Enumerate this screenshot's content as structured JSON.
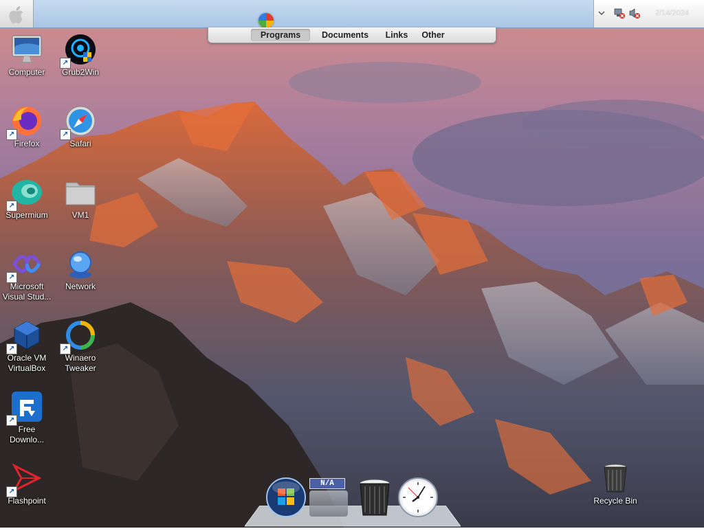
{
  "topbar": {
    "tray": {
      "clock": "2/14/2024"
    }
  },
  "tabs": [
    {
      "label": "Programs",
      "active": true
    },
    {
      "label": "Documents",
      "active": false
    },
    {
      "label": "Links",
      "active": false
    },
    {
      "label": "Other",
      "active": false
    }
  ],
  "desktop": {
    "icons": [
      {
        "label": "Computer",
        "icon": "monitor-icon"
      },
      {
        "label": "Grub2Win",
        "icon": "grub2win-icon"
      },
      {
        "label": "Firefox",
        "icon": "firefox-icon"
      },
      {
        "label": "Safari",
        "icon": "safari-icon"
      },
      {
        "label": "Supermium",
        "icon": "supermium-icon"
      },
      {
        "label": "VM1",
        "icon": "folder-icon"
      },
      {
        "label": "Microsoft Visual Stud...",
        "icon": "visual-studio-icon"
      },
      {
        "label": "Network",
        "icon": "network-icon"
      },
      {
        "label": "Oracle VM VirtualBox",
        "icon": "virtualbox-icon"
      },
      {
        "label": "Winaero Tweaker",
        "icon": "winaero-icon"
      },
      {
        "label": "Free Downlo...",
        "icon": "free-download-manager-icon"
      },
      {
        "label": "Flashpoint",
        "icon": "flashpoint-icon"
      },
      {
        "label": "Recycle Bin",
        "icon": "recycle-bin-icon"
      }
    ]
  },
  "dock": {
    "badge": "N/A",
    "items": [
      "start-orb-icon",
      "stack-icon",
      "trash-icon",
      "clock-icon"
    ]
  }
}
